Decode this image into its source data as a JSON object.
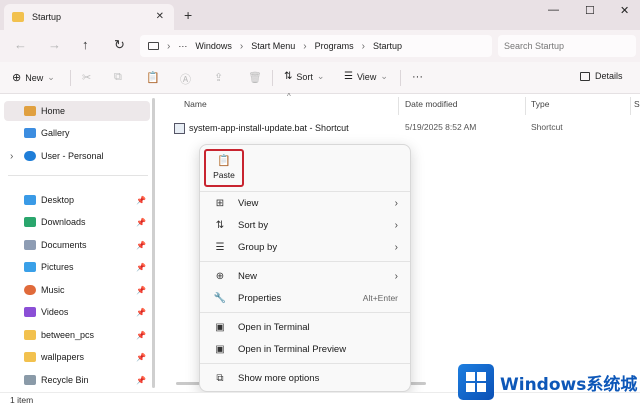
{
  "tab": {
    "title": "Startup",
    "close": "✕",
    "new": "+"
  },
  "window_controls": {
    "minimize": "—",
    "maximize": "☐",
    "close": "✕"
  },
  "nav": {
    "back": "←",
    "forward": "→",
    "up": "↑",
    "refresh": "↻"
  },
  "path": {
    "ellipsis": "···",
    "segments": [
      "Windows",
      "Start Menu",
      "Programs",
      "Startup"
    ]
  },
  "search": {
    "placeholder": "Search Startup"
  },
  "toolbar": {
    "new_label": "New",
    "sort_label": "Sort",
    "view_label": "View",
    "more": "···",
    "details_label": "Details"
  },
  "sidebar": {
    "top": [
      {
        "label": "Home",
        "icon": "home-icon",
        "color": "#e0a040"
      },
      {
        "label": "Gallery",
        "icon": "gallery-icon",
        "color": "#3c8de0"
      },
      {
        "label": "User - Personal",
        "icon": "cloud-icon",
        "color": "#1f7ed8"
      }
    ],
    "pinned": [
      {
        "label": "Desktop",
        "icon": "desktop-icon",
        "color": "#3a9ae6"
      },
      {
        "label": "Downloads",
        "icon": "download-icon",
        "color": "#2aa66d"
      },
      {
        "label": "Documents",
        "icon": "documents-icon",
        "color": "#8d9cb3"
      },
      {
        "label": "Pictures",
        "icon": "pictures-icon",
        "color": "#3aa0e8"
      },
      {
        "label": "Music",
        "icon": "music-icon",
        "color": "#e06a3a"
      },
      {
        "label": "Videos",
        "icon": "videos-icon",
        "color": "#8b4fd6"
      },
      {
        "label": "between_pcs",
        "icon": "folder-icon",
        "color": "#f2c14e"
      },
      {
        "label": "wallpapers",
        "icon": "folder-icon",
        "color": "#f2c14e"
      },
      {
        "label": "Recycle Bin",
        "icon": "recycle-bin-icon",
        "color": "#8a9aa8"
      }
    ],
    "pin_glyph": "📌"
  },
  "columns": {
    "name": "Name",
    "date": "Date modified",
    "type": "Type",
    "size": "S"
  },
  "files": [
    {
      "name": "system-app-install-update.bat - Shortcut",
      "date": "5/19/2025 8:52 AM",
      "type": "Shortcut"
    }
  ],
  "context_menu": {
    "paste_label": "Paste",
    "items": [
      {
        "label": "View",
        "icon": "view-icon",
        "glyph": "⊞",
        "arrow": "›"
      },
      {
        "label": "Sort by",
        "icon": "sort-icon",
        "glyph": "⇅",
        "arrow": "›"
      },
      {
        "label": "Group by",
        "icon": "group-icon",
        "glyph": "☰",
        "arrow": "›"
      },
      {
        "label": "New",
        "icon": "new-icon",
        "glyph": "⊕",
        "arrow": "›"
      },
      {
        "label": "Properties",
        "icon": "wrench-icon",
        "glyph": "🔧",
        "shortcut": "Alt+Enter"
      },
      {
        "label": "Open in Terminal",
        "icon": "terminal-icon",
        "glyph": "▣"
      },
      {
        "label": "Open in Terminal Preview",
        "icon": "terminal-preview-icon",
        "glyph": "▣"
      },
      {
        "label": "Show more options",
        "icon": "more-options-icon",
        "glyph": "⧉"
      }
    ]
  },
  "status": {
    "count": "1 item"
  },
  "watermark": {
    "text": "Windows系统城"
  }
}
